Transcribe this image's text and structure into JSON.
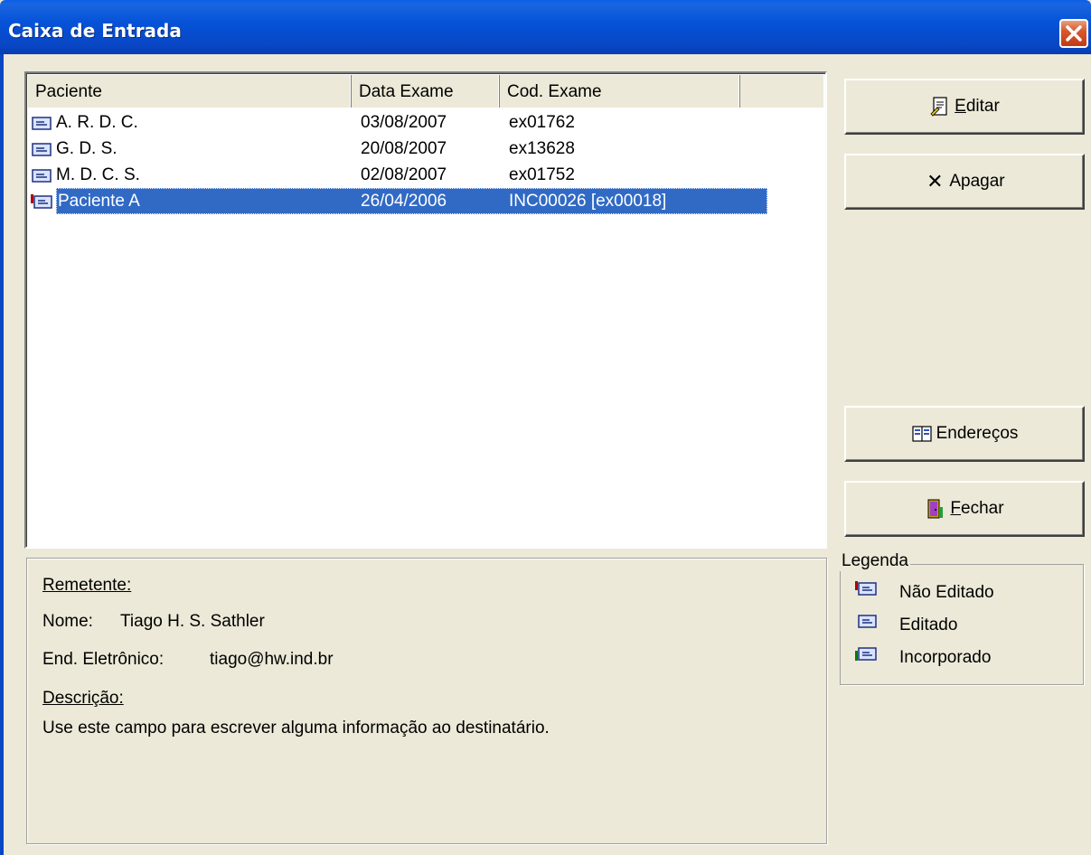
{
  "window": {
    "title": "Caixa de Entrada",
    "close_glyph": "✕"
  },
  "list": {
    "columns": [
      "Paciente",
      "Data Exame",
      "Cod. Exame"
    ],
    "rows": [
      {
        "status": "edited-icon",
        "patient": "A. R. D. C.",
        "date": "03/08/2007",
        "code": "ex01762"
      },
      {
        "status": "edited-icon",
        "patient": "G. D. S.",
        "date": "20/08/2007",
        "code": "ex13628"
      },
      {
        "status": "edited-icon",
        "patient": "M. D. C. S.",
        "date": "02/08/2007",
        "code": "ex01752"
      },
      {
        "status": "not-edited-icon",
        "patient": "Paciente A",
        "date": "26/04/2006",
        "code": "INC00026 [ex00018]",
        "selected": true
      }
    ]
  },
  "buttons": {
    "edit": {
      "icon": "edit-doc-icon",
      "mnemonic": "E",
      "rest": "ditar"
    },
    "delete": {
      "icon": "x-icon",
      "glyph": "✕",
      "label": "Apagar"
    },
    "addresses": {
      "icon": "address-book-icon",
      "label": "Endereços"
    },
    "close": {
      "icon": "exit-door-icon",
      "mnemonic": "F",
      "rest": "echar"
    }
  },
  "sender": {
    "heading": "Remetente:",
    "name_label": "Nome:",
    "name": "Tiago H. S. Sathler",
    "email_label": "End. Eletrônico:",
    "email": "tiago@hw.ind.br",
    "desc_heading": "Descrição:",
    "description": "Use este campo para escrever alguma informação ao destinatário."
  },
  "legend": {
    "title": "Legenda",
    "items": [
      {
        "icon": "not-edited-icon",
        "label": "Não Editado"
      },
      {
        "icon": "edited-icon",
        "label": "Editado"
      },
      {
        "icon": "incorporated-icon",
        "label": "Incorporado"
      }
    ]
  },
  "colors": {
    "title_bar": "#0553d8",
    "selection": "#316ac5",
    "dialog_bg": "#ece9d8",
    "close_button": "#d8582e",
    "not_edited_marker": "#b00000",
    "incorporated_marker": "#008000"
  }
}
